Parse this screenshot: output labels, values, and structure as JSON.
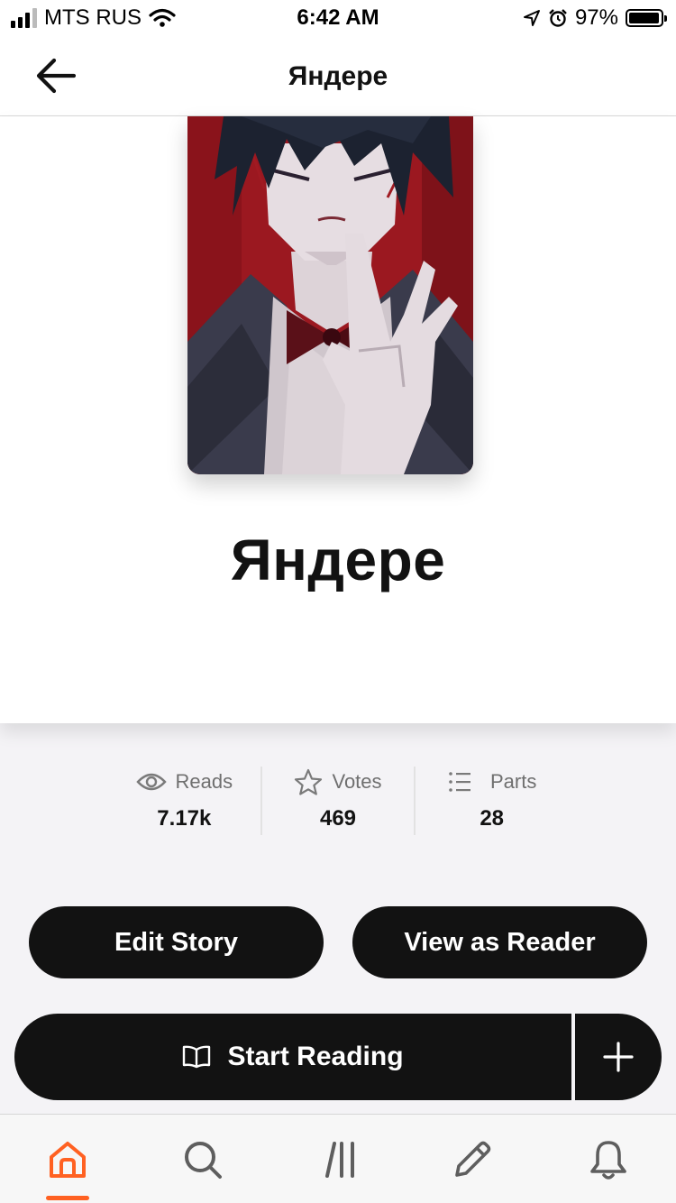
{
  "status_bar": {
    "carrier": "MTS RUS",
    "time": "6:42 AM",
    "battery": "97%",
    "battery_level": 0.97
  },
  "header": {
    "title": "Яндере"
  },
  "story": {
    "title": "Яндере"
  },
  "stats": {
    "reads_label": "Reads",
    "reads_value": "7.17k",
    "votes_label": "Votes",
    "votes_value": "469",
    "parts_label": "Parts",
    "parts_value": "28"
  },
  "actions": {
    "edit_label": "Edit Story",
    "view_label": "View as Reader",
    "start_label": "Start Reading"
  },
  "tab_bar": {
    "active": "home",
    "accent": "#ff6122",
    "icons": [
      "home-icon",
      "search-icon",
      "library-icon",
      "write-icon",
      "notifications-icon"
    ]
  }
}
